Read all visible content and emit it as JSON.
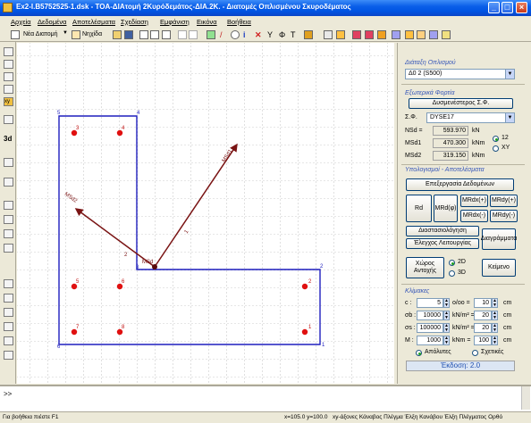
{
  "window": {
    "title": "Ex2-I.B5752525-1.dsk - TOA-ΔΙΑτομή 2Κυρόδεμάτος-ΔΙΑ.2Κ. - Διατομές Οπλισμένου Σκυροδέματος"
  },
  "menu": [
    "Αρχεία",
    "Δεδομένα",
    "Αποτελέσματα",
    "Σχεδίαση",
    "Εμφάνιση",
    "Εικόνα",
    "Βοήθεια"
  ],
  "toolbar": {
    "new_section_label": "Νέα Διατομή",
    "sketch_label": "Νηχίδα"
  },
  "canvas": {
    "node_labels": [
      "1",
      "2",
      "3",
      "4",
      "5",
      "6",
      "7",
      "8"
    ],
    "corner_labels": [
      "1",
      "2",
      "3",
      "4",
      "5",
      "6"
    ],
    "vector_labels": {
      "msd": "MSd",
      "msd1": "MSd1",
      "msd2": "MSd2",
      "line1": "1",
      "line2": "2"
    }
  },
  "panel": {
    "rebar_section_title": "Διάταξη Οπλισμού",
    "rebar_selected": "Δ0 2 (S500)",
    "loads_title": "Εξωτερικά Φορτία",
    "worst_button": "Δυσμενέστερος Σ.Φ.",
    "sf_label": "Σ.Φ.",
    "sf_selected": "DYSE17",
    "nsd_label": "NSd =",
    "nsd_value": "593.970",
    "nsd_unit": "kN",
    "msd1_label": "MSd1",
    "msd1_value": "470.300",
    "msd1_unit": "kNm",
    "msd2_label": "MSd2",
    "msd2_value": "319.150",
    "msd2_unit": "kNm",
    "opt_12": "12",
    "opt_xy": "XY",
    "calc_title": "Υπολογισμοί - Αποτελέσματα",
    "process_button": "Επεξεργασία Δεδομένων",
    "rd_button": "Rd",
    "mrd_phi_button": "MRd(φ)",
    "mrdx_plus": "MRdx(+)",
    "mrdx_minus": "MRdx(-)",
    "mrdy_plus": "MRdy(+)",
    "mrdy_minus": "MRdy(-)",
    "sizing_button": "Διαστασιολόγηση",
    "check_button": "Έλεγχος Λειτουργίας",
    "diagrams_button": "Διαγράμματα",
    "space_button": "Χώρος Αντοχής",
    "opt_2d": "2D",
    "opt_3d": "3D",
    "text_button": "Κείμενο",
    "scales_title": "Κλίμακες",
    "c_label": "c :",
    "c_value": "5",
    "c_unit": "ο/οο =",
    "c_value2": "10",
    "c_unit2": "cm",
    "sc_label": "σb :",
    "sc_value": "10000",
    "sc_unit": "kN/m² =",
    "sc_value2": "20",
    "sc_unit2": "cm",
    "ss_label": "σs :",
    "ss_value": "100000",
    "ss_unit": "kN/m² =",
    "ss_value2": "20",
    "ss_unit2": "cm",
    "m_label": "M :",
    "m_value": "1000",
    "m_unit": "kNm =",
    "m_value2": "100",
    "m_unit2": "cm",
    "opt_absolute": "Απόλυτες",
    "opt_relative": "Σχετικές",
    "version": "Έκδοση: 2.0"
  },
  "command": {
    "prompt": ">>"
  },
  "status": {
    "help": "Για βοήθεια πιέστε F1",
    "coords": "x=105.0  y=100.0",
    "flags": "xy-άξονες  Κάναβος  Πλέγμα  Έλξη Κανάβου  Έλξη Πλέγματος  Ορθό"
  },
  "colors": {
    "accent": "#0054e3",
    "section_outline": "#1f1fbe",
    "rebar": "#e01010",
    "vector": "#7a1414"
  }
}
